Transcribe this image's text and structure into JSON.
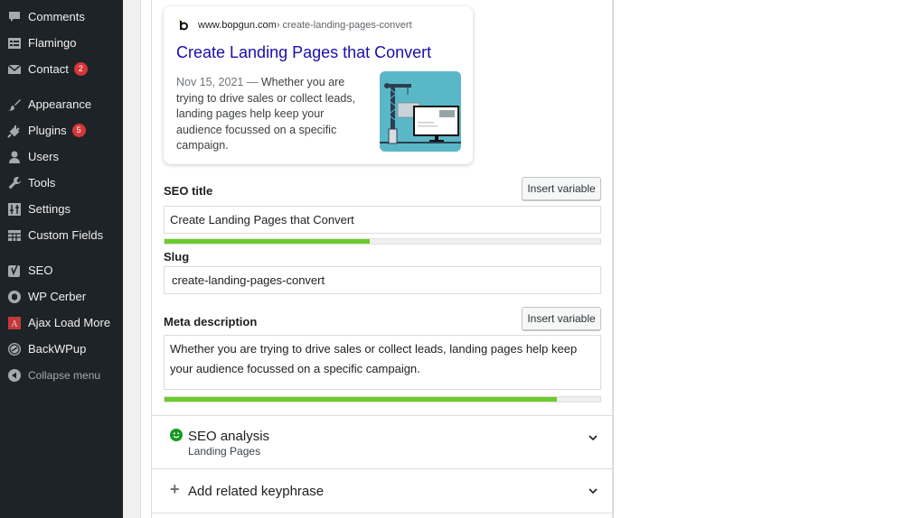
{
  "sidebar": {
    "items": [
      {
        "label": "Comments",
        "icon": "comment-icon"
      },
      {
        "label": "Flamingo",
        "icon": "flamingo-icon"
      },
      {
        "label": "Contact",
        "icon": "mail-icon",
        "badge": "2"
      },
      {
        "label": "Appearance",
        "icon": "paintbrush-icon"
      },
      {
        "label": "Plugins",
        "icon": "plugin-icon",
        "badge": "5"
      },
      {
        "label": "Users",
        "icon": "user-icon"
      },
      {
        "label": "Tools",
        "icon": "wrench-icon"
      },
      {
        "label": "Settings",
        "icon": "settings-icon"
      },
      {
        "label": "Custom Fields",
        "icon": "table-icon"
      },
      {
        "label": "SEO",
        "icon": "yoast-icon"
      },
      {
        "label": "WP Cerber",
        "icon": "cerber-icon"
      },
      {
        "label": "Ajax Load More",
        "icon": "ajax-load-more-icon"
      },
      {
        "label": "BackWPup",
        "icon": "backwpup-icon"
      }
    ],
    "collapse_label": "Collapse menu"
  },
  "snippet": {
    "domain": "www.bopgun.com",
    "breadcrumb": " › create-landing-pages-convert",
    "title": "Create Landing Pages that Convert",
    "date": "Nov 15, 2021",
    "separator": " — ",
    "description": "Whether you are trying to drive sales or collect leads, landing pages help keep your audience focussed on a specific campaign."
  },
  "seo_title": {
    "label": "SEO title",
    "insert_label": "Insert variable",
    "value": "Create Landing Pages that Convert",
    "progress_percent": 47,
    "progress_color": "#6bcb2c"
  },
  "slug": {
    "label": "Slug",
    "value": "create-landing-pages-convert"
  },
  "meta_description": {
    "label": "Meta description",
    "insert_label": "Insert variable",
    "value": "Whether you are trying to drive sales or collect leads, landing pages help keep your audience focussed on a specific campaign.",
    "progress_percent": 90,
    "progress_color": "#6bcb2c"
  },
  "seo_analysis": {
    "title": "SEO analysis",
    "subtitle": "Landing Pages",
    "status": "good",
    "status_color": "#159a22"
  },
  "related_keyphrase": {
    "title": "Add related keyphrase"
  }
}
